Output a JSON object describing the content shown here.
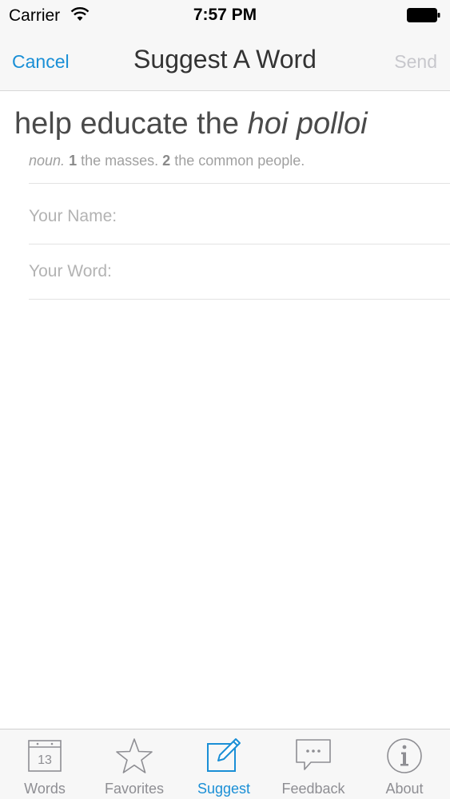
{
  "status_bar": {
    "carrier": "Carrier",
    "time": "7:57 PM"
  },
  "nav": {
    "cancel_label": "Cancel",
    "title": "Suggest A Word",
    "send_label": "Send"
  },
  "word": {
    "title_prefix": "help educate the",
    "title_word": "hoi polloi",
    "part_of_speech": "noun.",
    "def1_num": "1",
    "def1_text": "the masses.",
    "def2_num": "2",
    "def2_text": "the common people."
  },
  "form": {
    "name_label": "Your Name:",
    "word_label": "Your Word:"
  },
  "tabs": [
    {
      "label": "Words",
      "icon": "calendar-icon",
      "calendar_day": "13"
    },
    {
      "label": "Favorites",
      "icon": "star-icon"
    },
    {
      "label": "Suggest",
      "icon": "compose-icon",
      "active": true
    },
    {
      "label": "Feedback",
      "icon": "speech-bubble-icon"
    },
    {
      "label": "About",
      "icon": "info-icon"
    }
  ],
  "colors": {
    "accent": "#1a8fd6",
    "inactive_tab": "#8e8e93",
    "title_text": "#4a4a4a"
  }
}
